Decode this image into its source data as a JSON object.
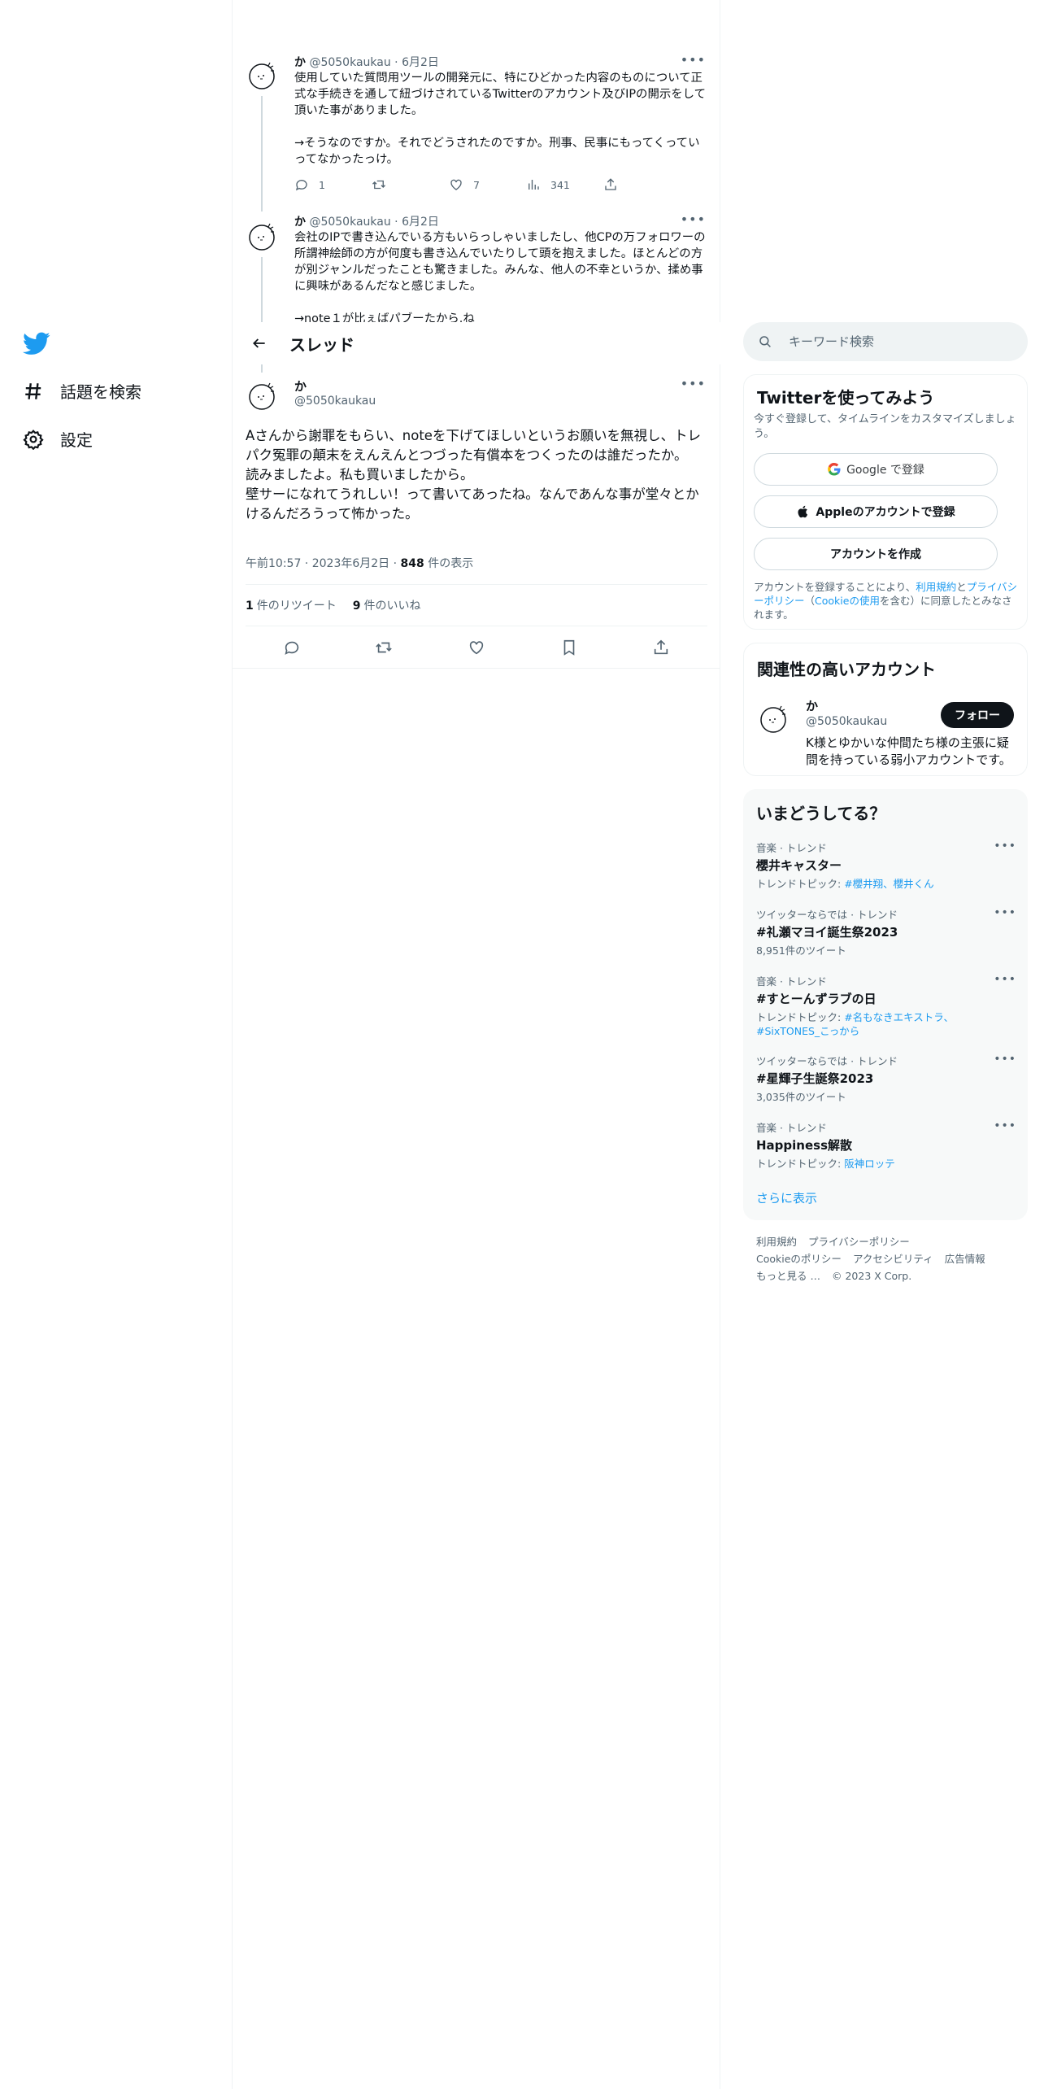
{
  "nav": {
    "explore_label": "話題を検索",
    "settings_label": "設定"
  },
  "thread": {
    "tweets": [
      {
        "name": "か",
        "handle": "@5050kaukau",
        "date": "6月2日",
        "text": "使用していた質問用ツールの開発元に、特にひどかった内容のものについて正式な手続きを通して紐づけされているTwitterのアカウント及びIPの開示をして頂いた事がありました。\n\n→そうなのですか。それでどうされたのですか。刑事、民事にもってくっていってなかったっけ。",
        "replies": "1",
        "retweets": "",
        "likes": "7",
        "views": "341"
      },
      {
        "name": "か",
        "handle": "@5050kaukau",
        "date": "6月2日",
        "text": "会社のIPで書き込んでいる方もいらっしゃいましたし、他CPの万フォロワーの所謂神絵師の方が何度も書き込んでいたりして頭を抱えました。ほとんどの方が別ジャンルだったことも驚きました。みんな、他人の不幸というか、揉め事に興味があるんだなと感じました。\n\n→note１が比ぇばパブーたから.ね"
      }
    ]
  },
  "header": {
    "title": "スレッド"
  },
  "focus": {
    "name": "か",
    "handle": "@5050kaukau",
    "text": "Aさんから謝罪をもらい、noteを下げてほしいというお願いを無視し、トレパク冤罪の顛末をえんえんとつづった有償本をつくったのは誰だったか。\n読みましたよ。私も買いましたから。\n壁サーになれてうれしい！って書いてあったね。なんであんな事が堂々とかけるんだろうって怖かった。",
    "time": "午前10:57",
    "date": "2023年6月2日",
    "views": "848",
    "views_label": "件の表示",
    "retweet_count": "1",
    "retweet_label": "件のリツイート",
    "like_count": "9",
    "like_label": "件のいいね"
  },
  "search": {
    "placeholder": "キーワード検索"
  },
  "signup": {
    "title": "Twitterを使ってみよう",
    "subtitle": "今すぐ登録して、タイムラインをカスタマイズしましょう。",
    "google_label": "Google で登録",
    "apple_label": "Appleのアカウントで登録",
    "create_label": "アカウントを作成",
    "legal_pre": "アカウントを登録することにより、",
    "legal_terms": "利用規約",
    "legal_and": "と",
    "legal_privacy": "プライバシーポリシー",
    "legal_mid": "（",
    "legal_cookie": "Cookieの使用",
    "legal_post": "を含む）に同意したとみなされます。"
  },
  "relevant": {
    "title": "関連性の高いアカウント",
    "name": "か",
    "handle": "@5050kaukau",
    "follow_label": "フォロー",
    "bio": "K様とゆかいな仲間たち様の主張に疑問を持っている弱小アカウントです。"
  },
  "trends": {
    "title": "いまどうしてる？",
    "items": [
      {
        "context": "音楽 · トレンド",
        "name": "櫻井キャスター",
        "sub_prefix": "トレンドトピック: ",
        "sub_link": "#櫻井翔、櫻井くん",
        "sub": ""
      },
      {
        "context": "ツイッターならでは · トレンド",
        "name": "#礼瀬マヨイ誕生祭2023",
        "sub_prefix": "",
        "sub_link": "",
        "sub": "8,951件のツイート"
      },
      {
        "context": "音楽 · トレンド",
        "name": "#すとーんずラブの日",
        "sub_prefix": "トレンドトピック: ",
        "sub_link": "#名もなきエキストラ、#SixTONES_こっから",
        "sub": ""
      },
      {
        "context": "ツイッターならでは · トレンド",
        "name": "#星輝子生誕祭2023",
        "sub_prefix": "",
        "sub_link": "",
        "sub": "3,035件のツイート"
      },
      {
        "context": "音楽 · トレンド",
        "name": "Happiness解散",
        "sub_prefix": "トレンドトピック: ",
        "sub_link": "阪神ロッテ",
        "sub": ""
      }
    ],
    "show_more": "さらに表示"
  },
  "footer": {
    "links": [
      "利用規約",
      "プライバシーポリシー",
      "Cookieのポリシー",
      "アクセシビリティ",
      "広告情報",
      "もっと見る …"
    ],
    "copyright": "© 2023 X Corp."
  },
  "colors": {
    "accent": "#1d9bf0",
    "text": "#0f1419",
    "muted": "#536471",
    "border": "#eff3f4"
  }
}
